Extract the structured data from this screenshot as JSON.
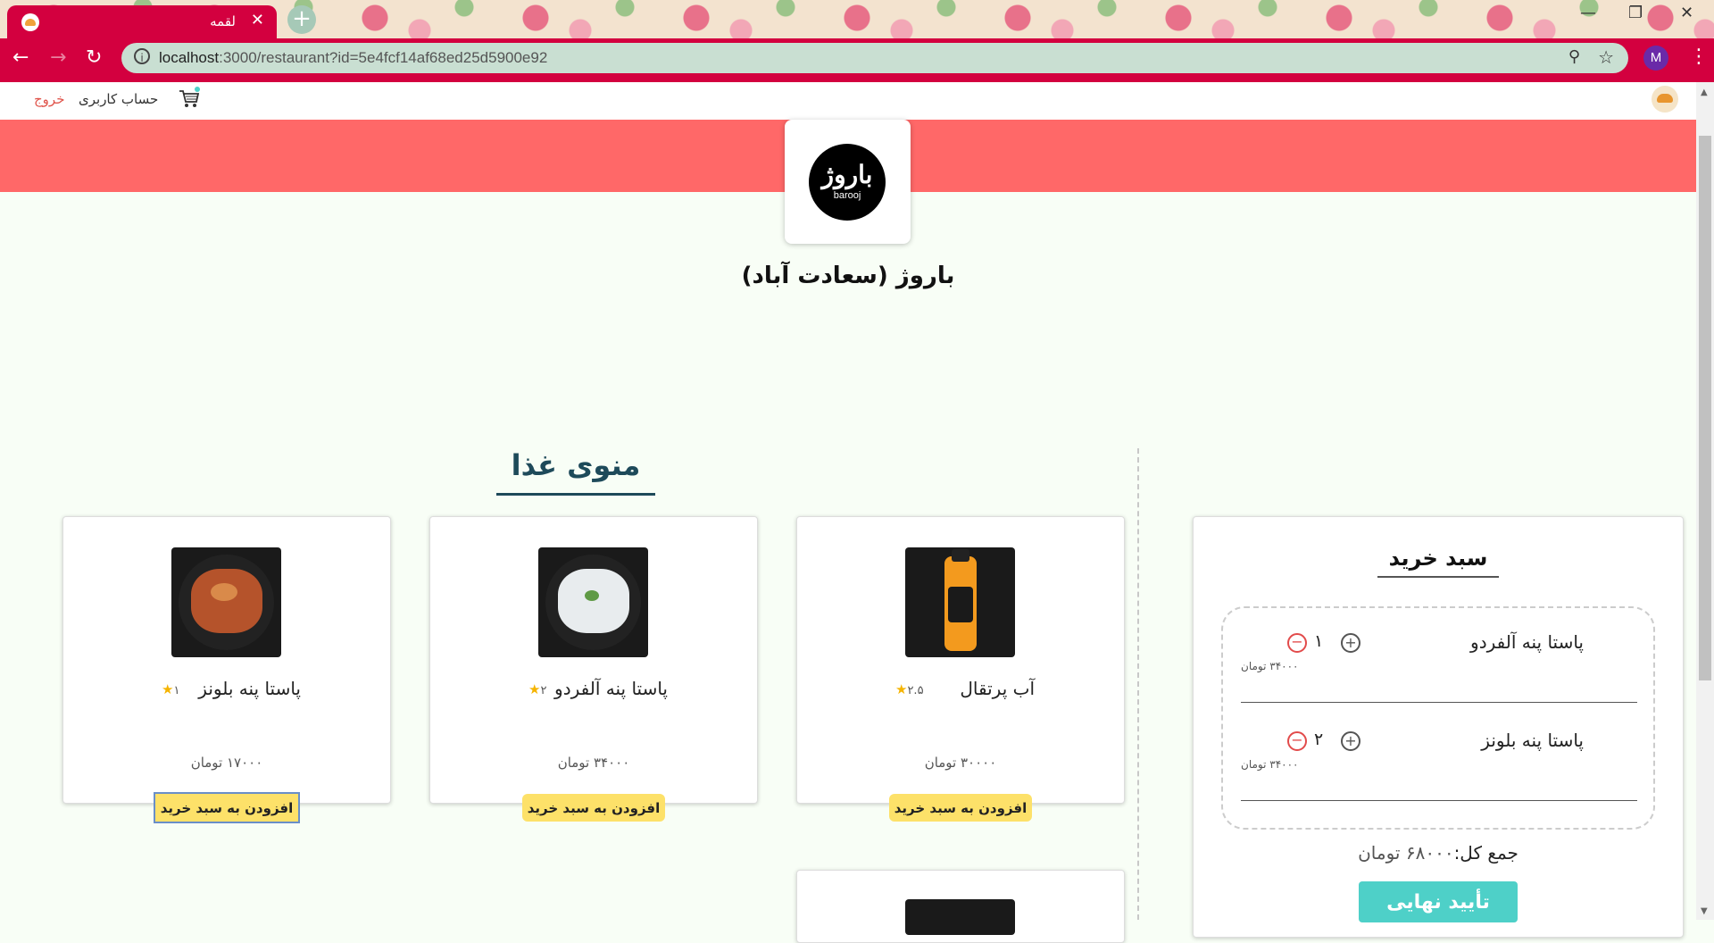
{
  "browser": {
    "tab_title": "لقمه",
    "tab_close": "✕",
    "new_tab": "+",
    "url_host": "localhost",
    "url_rest": ":3000/restaurant?id=5e4fcf14af68ed25d5900e92",
    "profile_initial": "M"
  },
  "header": {
    "logout": "خروج",
    "account": "حساب کاربری"
  },
  "restaurant": {
    "name": "باروژ (سعادت آباد)",
    "logo_text": "باروژ",
    "logo_subtext": "barooj",
    "hero_color": "#ff6868"
  },
  "menu": {
    "title": "منوی غذا",
    "add_label": "افزودن به سبد خرید",
    "items": [
      {
        "name": "آب پرتقال",
        "rating": "۲.۵",
        "price": "۳۰۰۰۰ تومان"
      },
      {
        "name": "پاستا پنه آلفردو",
        "rating": "۲",
        "price": "۳۴۰۰۰ تومان"
      },
      {
        "name": "پاستا پنه بلونز",
        "rating": "۱",
        "price": "۱۷۰۰۰ تومان"
      }
    ]
  },
  "cart": {
    "title": "سبد خرید",
    "items": [
      {
        "name": "پاستا پنه آلفردو",
        "qty": "۱",
        "price": "۳۴۰۰۰ تومان"
      },
      {
        "name": "پاستا پنه بلونز",
        "qty": "۲",
        "price": "۳۴۰۰۰ تومان"
      }
    ],
    "total_label": "جمع کل:",
    "total_value": "۶۸۰۰۰ تومان",
    "confirm_label": "تأیید نهایی"
  },
  "colors": {
    "brand": "#d3003f",
    "add_button": "#fde169",
    "confirm_button": "#4ed0c8",
    "menu_title": "#1e4a5a"
  }
}
